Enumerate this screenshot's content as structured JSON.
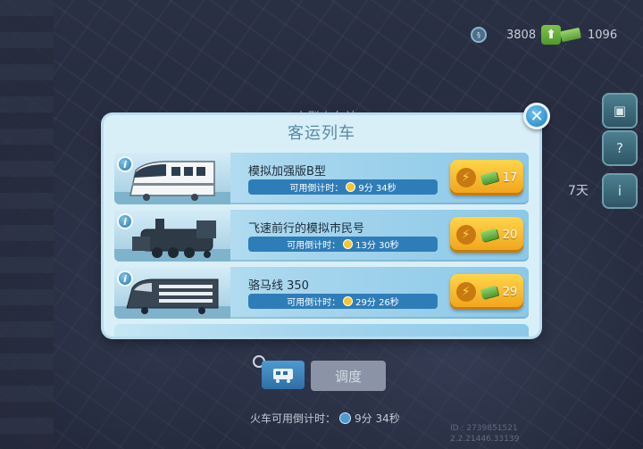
{
  "hud": {
    "simcash_value": "3808",
    "money_value": "1096"
  },
  "side": {
    "days_label": "7天"
  },
  "station_title": "小型火车站",
  "modal": {
    "title": "客运列车",
    "trains": [
      {
        "name": "模拟加强版B型",
        "timer_label": "可用倒计时：",
        "timer_value": "9分 34秒",
        "price": "17"
      },
      {
        "name": "飞速前行的模拟市民号",
        "timer_label": "可用倒计时：",
        "timer_value": "13分 30秒",
        "price": "20"
      },
      {
        "name": "骆马线 350",
        "timer_label": "可用倒计时：",
        "timer_value": "29分 26秒",
        "price": "29"
      }
    ]
  },
  "dispatch": {
    "button_label": "调度",
    "countdown_label": "火车可用倒计时：",
    "countdown_value": "9分 34秒"
  },
  "build_id": [
    "ID : 2739851521",
    "2.2.21446.33139"
  ],
  "colors": {
    "accent_blue": "#2f7db8",
    "buy_gold": "#f0a21a",
    "modal_bg": "#d9eff8"
  }
}
